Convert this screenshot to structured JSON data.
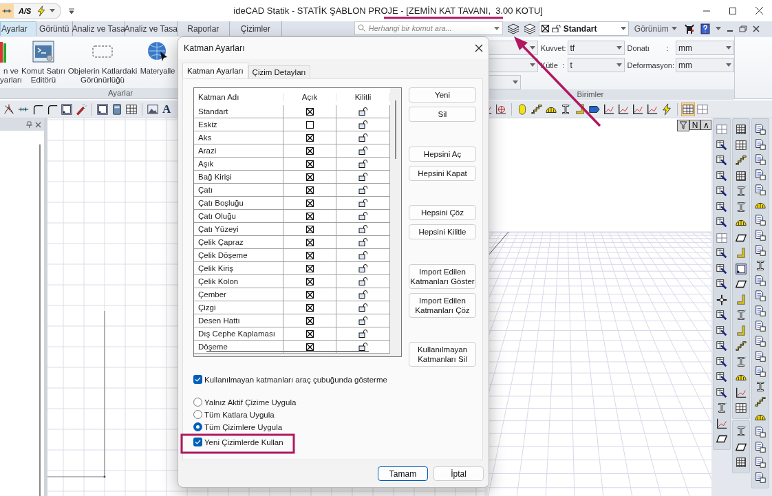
{
  "window": {
    "title": "ideCAD Statik - STATİK ŞABLON PROJE - [ZEMİN KAT TAVANI,  3.00 KOTU]",
    "quick_access_label": "A/S"
  },
  "ribbon_tabs": [
    {
      "label": "Ayarlar",
      "selected": true
    },
    {
      "label": "Görüntü",
      "selected": false
    },
    {
      "label": "Analiz ve Tasa",
      "selected": false
    },
    {
      "label": "Analiz ve Tasa",
      "selected": false
    },
    {
      "label": "Raporlar",
      "selected": false
    },
    {
      "label": "Çizimler",
      "selected": false
    }
  ],
  "command_search": {
    "placeholder": "Herhangi bir komut ara..."
  },
  "layer_combo": {
    "value": "Standart"
  },
  "view_menu": {
    "label": "Görünüm"
  },
  "settings_group": {
    "label": "Ayarlar",
    "items": [
      "n ve\nyarları",
      "Komut Satırı\nEditörü",
      "Objelerin Katlardaki\nGörünürlüğü",
      "Materyalle"
    ]
  },
  "units_group": {
    "label": "Birimler",
    "fields": [
      {
        "label": "Kuvvet:",
        "value": "tf"
      },
      {
        "label": "Donatı        :",
        "value": "mm"
      },
      {
        "label": "Kütle  :",
        "value": "t"
      },
      {
        "label": "Deformasyon:",
        "value": "mm"
      }
    ]
  },
  "toolbar": {
    "text_tool": "A"
  },
  "viewport_buttons": [
    "N",
    "∧"
  ],
  "dialog": {
    "title": "Katman Ayarları",
    "tabs": [
      {
        "label": "Katman Ayarları",
        "selected": true
      },
      {
        "label": "Çizim Detayları",
        "selected": false
      }
    ],
    "columns": [
      "Katman Adı",
      "Açık",
      "Kilitli"
    ],
    "rows": [
      {
        "name": "Standart",
        "open": true,
        "locked": false
      },
      {
        "name": "Eskiz",
        "open": false,
        "locked": false
      },
      {
        "name": "Aks",
        "open": true,
        "locked": false
      },
      {
        "name": "Arazi",
        "open": true,
        "locked": false
      },
      {
        "name": "Aşık",
        "open": true,
        "locked": false
      },
      {
        "name": "Bağ Kirişi",
        "open": true,
        "locked": false
      },
      {
        "name": "Çatı",
        "open": true,
        "locked": false
      },
      {
        "name": "Çatı Boşluğu",
        "open": true,
        "locked": false
      },
      {
        "name": "Çatı Oluğu",
        "open": true,
        "locked": false
      },
      {
        "name": "Çatı Yüzeyi",
        "open": true,
        "locked": false
      },
      {
        "name": "Çelik Çapraz",
        "open": true,
        "locked": false
      },
      {
        "name": "Çelik Döşeme",
        "open": true,
        "locked": false
      },
      {
        "name": "Çelik Kiriş",
        "open": true,
        "locked": false
      },
      {
        "name": "Çelik Kolon",
        "open": true,
        "locked": false
      },
      {
        "name": "Çember",
        "open": true,
        "locked": false
      },
      {
        "name": "Çizgi",
        "open": true,
        "locked": false
      },
      {
        "name": "Desen Hattı",
        "open": true,
        "locked": false
      },
      {
        "name": "Dış Cephe Kaplaması",
        "open": true,
        "locked": false
      },
      {
        "name": "Döşeme",
        "open": true,
        "locked": false
      }
    ],
    "button_groups": [
      [
        "Yeni",
        "Sil"
      ],
      [
        "Hepsini Aç",
        "Hepsini Kapat"
      ],
      [
        "Hepsini Çöz",
        "Hepsini Kilitle"
      ],
      [
        "Import Edilen\nKatmanları Göster",
        "Import Edilen\nKatmanları Çöz"
      ],
      [
        "Kullanılmayan\nKatmanları Sil"
      ]
    ],
    "hide_unused": {
      "label": "Kullanılmayan katmanları araç çubuğunda gösterme",
      "checked": true
    },
    "apply_options": [
      {
        "label": "Yalnız Aktif Çizime Uygula",
        "selected": false
      },
      {
        "label": "Tüm Katlara Uygula",
        "selected": false
      },
      {
        "label": "Tüm Çizimlere Uygula",
        "selected": true
      }
    ],
    "use_in_new": {
      "label": "Yeni Çizimlerde Kullan",
      "checked": true
    },
    "footer_buttons": [
      {
        "label": "Tamam",
        "default": true
      },
      {
        "label": "İptal",
        "default": false
      }
    ]
  }
}
